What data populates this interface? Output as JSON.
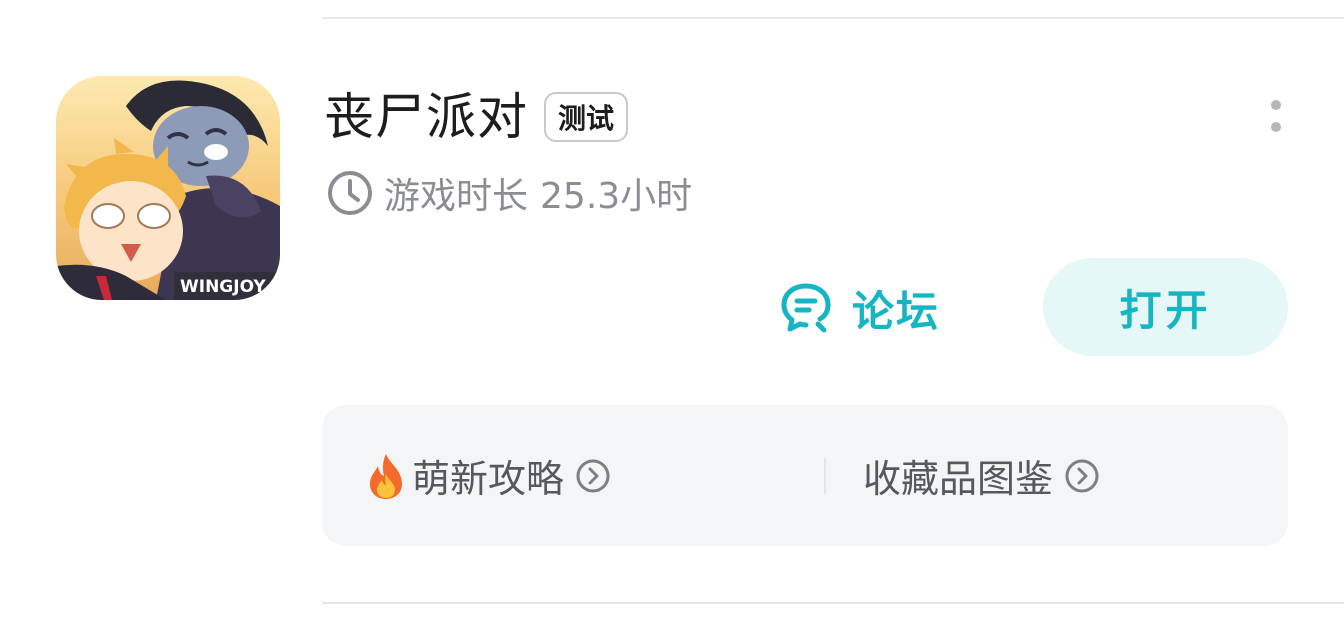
{
  "game": {
    "title": "丧尸派对",
    "tag": "测试",
    "playtime_label": "游戏时长",
    "playtime_value": "25.3小时",
    "icon_watermark": "WINGJOY"
  },
  "actions": {
    "forum_label": "论坛",
    "open_label": "打开"
  },
  "guides": [
    {
      "label": "萌新攻略",
      "icon": "fire-icon"
    },
    {
      "label": "收藏品图鉴",
      "icon": ""
    }
  ],
  "colors": {
    "accent": "#16b5c3",
    "open_button_bg": "#e6f7f8",
    "secondary_text": "#8a8d93",
    "guide_bg": "#f4f5f7"
  }
}
